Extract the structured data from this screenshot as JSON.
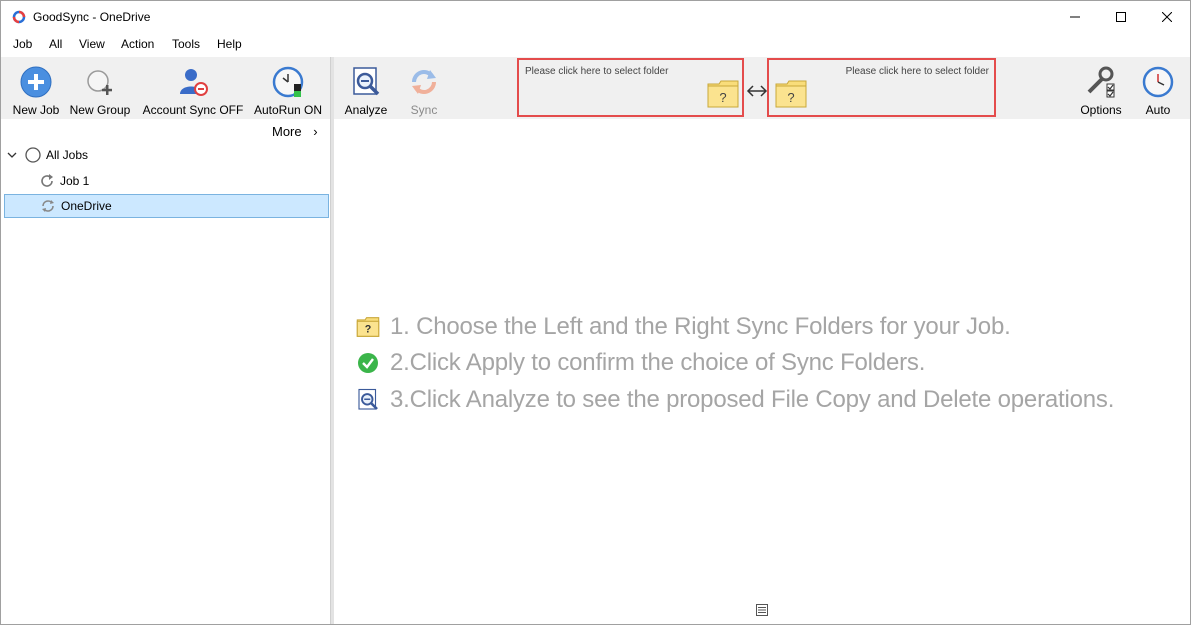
{
  "window": {
    "title": "GoodSync - OneDrive"
  },
  "menu": [
    "Job",
    "All",
    "View",
    "Action",
    "Tools",
    "Help"
  ],
  "toolbar": {
    "new_job": "New Job",
    "new_group": "New Group",
    "account_sync": "Account Sync OFF",
    "autorun": "AutoRun ON",
    "analyze": "Analyze",
    "sync": "Sync",
    "options": "Options",
    "auto": "Auto"
  },
  "folders": {
    "left_hint": "Please click here to select folder",
    "right_hint": "Please click here to select folder"
  },
  "left_pane": {
    "more": "More",
    "tree": [
      {
        "label": "All Jobs"
      },
      {
        "label": "Job 1"
      },
      {
        "label": "OneDrive",
        "selected": true
      }
    ]
  },
  "steps": [
    {
      "icon": "folder-question-icon",
      "text": "1. Choose the Left and the Right Sync Folders for your Job."
    },
    {
      "icon": "check-circle-icon",
      "text": "2.Click Apply to confirm the choice of Sync Folders."
    },
    {
      "icon": "analyze-icon",
      "text": "3.Click Analyze to see the proposed File Copy and Delete operations."
    }
  ],
  "colors": {
    "highlight_border": "#e44c4c",
    "selection_bg": "#cce8ff",
    "folder_yellow": "#f9dd7a",
    "step_text": "#a5a5a5"
  }
}
